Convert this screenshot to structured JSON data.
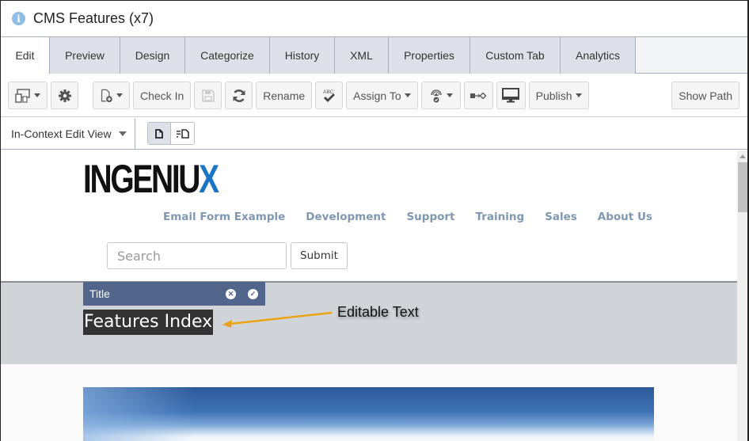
{
  "window": {
    "title": "CMS Features (x7)",
    "title_icon": "info-icon"
  },
  "tabs": [
    {
      "label": "Edit",
      "active": true
    },
    {
      "label": "Preview"
    },
    {
      "label": "Design"
    },
    {
      "label": "Categorize"
    },
    {
      "label": "History"
    },
    {
      "label": "XML"
    },
    {
      "label": "Properties"
    },
    {
      "label": "Custom Tab"
    },
    {
      "label": "Analytics"
    }
  ],
  "toolbar": {
    "device_icon": "device-layout-icon",
    "settings_icon": "gear-icon",
    "new_page_icon": "new-page-icon",
    "check_in_label": "Check In",
    "save_icon": "save-icon",
    "refresh_icon": "refresh-icon",
    "rename_label": "Rename",
    "spellcheck_icon": "spellcheck-abc-icon",
    "spellcheck_text": "ABC",
    "assign_to_label": "Assign To",
    "workflow_icon": "workflow-icon",
    "link_icon": "link-flow-icon",
    "monitor_icon": "monitor-icon",
    "publish_label": "Publish",
    "show_path_label": "Show Path"
  },
  "viewbar": {
    "view_label": "In-Context Edit View",
    "page_view_icon": "page-icon",
    "split_view_icon": "page-with-list-icon"
  },
  "site": {
    "logo_text": "INGENIU",
    "logo_accent": "X",
    "nav": [
      "Email Form Example",
      "Development",
      "Support",
      "Training",
      "Sales",
      "About Us"
    ],
    "search_placeholder": "Search",
    "submit_label": "Submit",
    "editor_label": "Title",
    "page_title": "Features Index",
    "annotation": "Editable Text"
  },
  "colors": {
    "nav_link": "#7f97b0",
    "editor_bar": "#52658a",
    "logo_accent": "#1a75c2",
    "annotation_arrow": "#e8a317"
  }
}
